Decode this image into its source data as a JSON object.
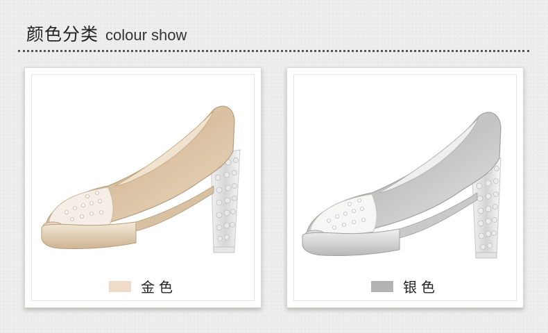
{
  "header": {
    "title_cn": "颜色分类",
    "title_en": "colour show"
  },
  "products": [
    {
      "label": "金色",
      "swatch_color": "#ecdcc8",
      "icon": "gold-peep-toe-heel-shoe"
    },
    {
      "label": "银色",
      "swatch_color": "#b3b3b3",
      "icon": "silver-peep-toe-heel-shoe"
    }
  ]
}
